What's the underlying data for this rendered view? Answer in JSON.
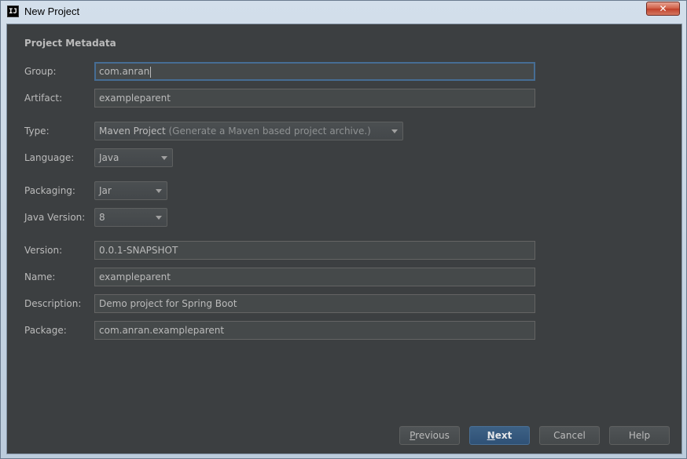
{
  "window": {
    "title": "New Project",
    "app_icon_text": "IJ"
  },
  "form": {
    "section_title": "Project Metadata",
    "group": {
      "label": "Group:",
      "value": "com.anran"
    },
    "artifact": {
      "label": "Artifact:",
      "value": "exampleparent"
    },
    "type": {
      "label": "Type:",
      "value": "Maven Project",
      "hint": "(Generate a Maven based project archive.)"
    },
    "language": {
      "label": "Language:",
      "value": "Java"
    },
    "packaging": {
      "label": "Packaging:",
      "value": "Jar"
    },
    "java_version": {
      "label": "Java Version:",
      "value": "8"
    },
    "version": {
      "label": "Version:",
      "value": "0.0.1-SNAPSHOT"
    },
    "name": {
      "label": "Name:",
      "value": "exampleparent"
    },
    "description": {
      "label": "Description:",
      "value": "Demo project for Spring Boot"
    },
    "package": {
      "label": "Package:",
      "value": "com.anran.exampleparent"
    }
  },
  "buttons": {
    "previous": {
      "first": "P",
      "rest": "revious"
    },
    "next": {
      "first": "N",
      "rest": "ext"
    },
    "cancel": "Cancel",
    "help": "Help"
  },
  "colors": {
    "panel_background": "#3c3f41",
    "text": "#bbbbbb",
    "focus_border": "#466d94",
    "primary_button": "#365880"
  }
}
